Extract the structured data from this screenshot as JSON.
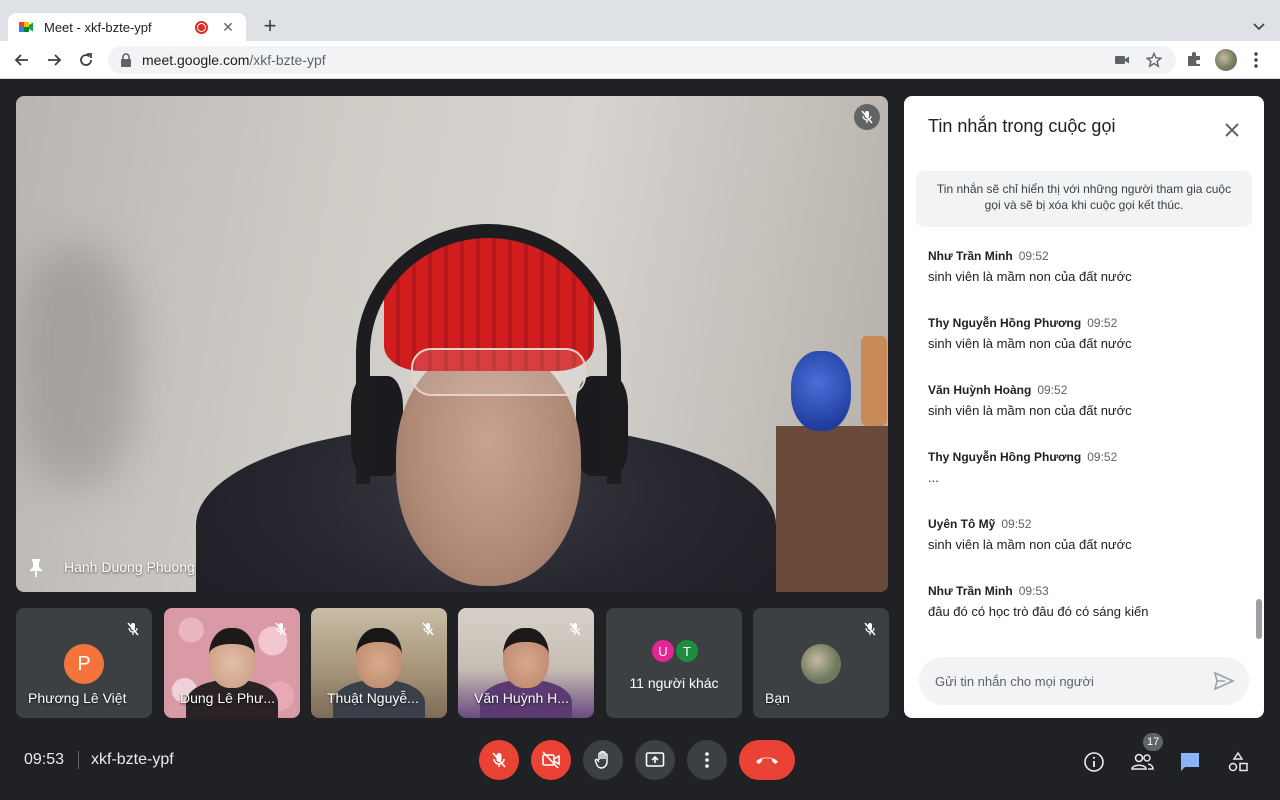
{
  "browser": {
    "tab_title": "Meet - xkf-bzte-ypf",
    "url_host": "meet.google.com",
    "url_path": "/xkf-bzte-ypf"
  },
  "main_video": {
    "name": "Hanh Duong Phuong"
  },
  "tiles": [
    {
      "name": "Phương Lê Việt",
      "initial": "P"
    },
    {
      "name": "Dung Lê Phư..."
    },
    {
      "name": "Thuật Nguyễ..."
    },
    {
      "name": "Văn Huỳnh H..."
    },
    {
      "label": "11 người khác",
      "avatars": [
        "U",
        "T"
      ]
    },
    {
      "name": "Bạn"
    }
  ],
  "chat": {
    "title": "Tin nhắn trong cuộc gọi",
    "notice": "Tin nhắn sẽ chỉ hiển thị với những người tham gia cuộc gọi và sẽ bị xóa khi cuộc gọi kết thúc.",
    "messages": [
      {
        "sender": "Như Trần Minh",
        "time": "09:52",
        "text": "sinh viên là mầm non của đất nước"
      },
      {
        "sender": "Thy Nguyễn Hồng Phương",
        "time": "09:52",
        "text": "sinh viên là mầm non của đất nước"
      },
      {
        "sender": "Văn Huỳnh Hoàng",
        "time": "09:52",
        "text": "sinh viên là mầm non của đất nước"
      },
      {
        "sender": "Thy Nguyễn Hồng Phương",
        "time": "09:52",
        "text": "..."
      },
      {
        "sender": "Uyên Tô Mỹ",
        "time": "09:52",
        "text": "sinh viên là mầm non của đất nước"
      },
      {
        "sender": "Như Trần Minh",
        "time": "09:53",
        "text": "đâu đó có học trò đâu đó có sáng kiến"
      }
    ],
    "input_placeholder": "Gửi tin nhắn cho mọi người"
  },
  "bottom_bar": {
    "time": "09:53",
    "meeting_code": "xkf-bzte-ypf",
    "participants_count": "17"
  },
  "colors": {
    "accent_red": "#ea4335",
    "chat_icon_blue": "#8ab4f8",
    "avatar_orange": "#f4753c",
    "avatar_u": "#e52592",
    "avatar_t": "#1e8e3e"
  }
}
